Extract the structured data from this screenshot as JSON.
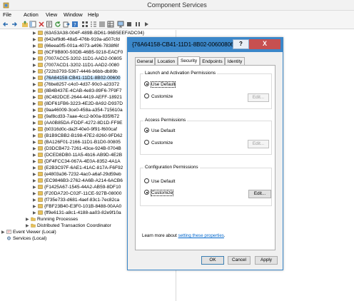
{
  "window": {
    "title": "Component Services"
  },
  "menu": [
    "File",
    "Action",
    "View",
    "Window",
    "Help"
  ],
  "toolbar": {
    "icons": [
      "back-icon",
      "forward-icon",
      "up-folder-icon",
      "show-tree-icon",
      "delete-icon",
      "properties-icon",
      "refresh-icon",
      "export-icon",
      "help-icon",
      "view-large-icon",
      "view-small-icon",
      "view-list-icon",
      "view-detail-icon",
      "computer-icon",
      "stop-icon",
      "pause-icon",
      "play-icon"
    ]
  },
  "tree": {
    "guids": [
      "{63A53A38-004F-489B-BD61-96B5EEFADC04}",
      "{642ef9d6-48a5-476b-919a-a507cfd",
      "{66eea0f5-001a-4073-a496-7838f6f",
      "{6CF9B800-50DB-46B5-9218-EACF0",
      "{7007ACC5-3202-11D1-AAD2-00805",
      "{7007ACD1-3202-11D1-AAD2-0080",
      "{722b3793-5367-4446-b6bb-db89b",
      "{76A64158-CB41-11D1-8B02-00600",
      "{76be8257-c4c0-4d37-90c0-a23372",
      "{8B4B437E-4CAB-4e83-89F6-7F9F7",
      "{8C482DCE-2644-4419-AEFF-18921",
      "{8DF61FB6-3223-4E2D-8A92-D937D",
      "{9aa46009-3ce0-458a-a354-715610a",
      "{9af8cd33-7aae-4cc2-b00a-835f672",
      "{AA0B85DA-FDDF-4272-8D1D-FF9E",
      "{b0316d0c-da2f-40e0-9f91-f600caf",
      "{B1B9CBB2-B198-47E2-8260-9FD62",
      "{BA126F01-2166-11D1-B1D0-00805",
      "{D3DCB472-7261-43ce-924B-0704B",
      "{DCED8DB0-11A5-4b16-AB9D-4E2B",
      "{DF4FCC34-067A-4E0A-8352-4A1A",
      "{E2B3C97F-6AE1-41AC-817A-F6F92",
      "{e4803a36-7232-4ac0-a6af-29d59eb",
      "{EC9846B3-2762-4A6B-A214-6ACB6",
      "{F1425A67-1545-44A2-AB59-8DF10",
      "{F20DA720-C02F-11CE-927B-08000",
      "{f735e733-d681-4aef-83c1-7ec82ca",
      "{FBF23B40-E3F0-101B-8488-00AA0",
      "{ff9e6131-a8c1-4188-aa03-82e9f10a"
    ],
    "bottom_items": [
      {
        "label": "Running Processes"
      },
      {
        "label": "Distributed Transaction Coordinator"
      }
    ],
    "root_items": [
      {
        "label": "Event Viewer (Local)"
      },
      {
        "label": "Services (Local)"
      }
    ]
  },
  "dialog": {
    "title": "{76A64158-CB41-11D1-8B02-00600806D9B6} P...",
    "help_label": "?",
    "close_label": "X",
    "tabs": [
      "General",
      "Location",
      "Security",
      "Endpoints",
      "Identity"
    ],
    "active_tab": "Security",
    "groups": [
      {
        "title": "Launch and Activation Permissions",
        "options": [
          "Use Default",
          "Customize"
        ],
        "selected": "Use Default",
        "edit_label": "Edit...",
        "edit_enabled": false
      },
      {
        "title": "Access Permissions",
        "options": [
          "Use Default",
          "Customize"
        ],
        "selected": "Use Default",
        "edit_label": "Edit...",
        "edit_enabled": false
      },
      {
        "title": "Configuration Permissions",
        "options": [
          "Use Default",
          "Customize"
        ],
        "selected": "Customize",
        "edit_label": "Edit...",
        "edit_enabled": true
      }
    ],
    "learn_prefix": "Learn more about ",
    "learn_link": "setting these properties",
    "learn_suffix": ".",
    "buttons": {
      "ok": "OK",
      "cancel": "Cancel",
      "apply": "Apply"
    }
  },
  "colors": {
    "dialog_title": "#3b87c9",
    "close": "#c75050",
    "link": "#0066cc",
    "selection": "#cde8ff"
  }
}
